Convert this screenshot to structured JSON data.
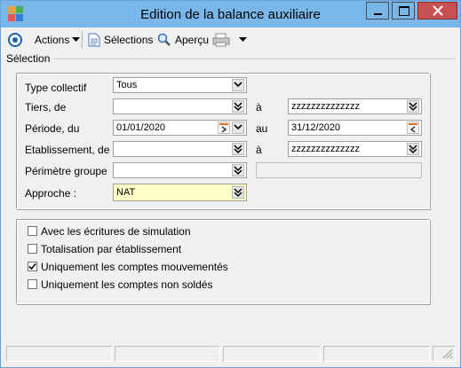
{
  "window": {
    "title": "Edition de la balance auxiliaire"
  },
  "toolbar": {
    "actions_label": "Actions",
    "selections_label": "Sélections",
    "apercu_label": "Aperçu"
  },
  "section": {
    "label": "Sélection"
  },
  "form": {
    "type_collectif": {
      "label": "Type collectif",
      "value": "Tous"
    },
    "tiers": {
      "label": "Tiers, de",
      "from": "",
      "sep": "à",
      "to": "zzzzzzzzzzzzzz"
    },
    "periode": {
      "label": "Période, du",
      "from": "01/01/2020",
      "sep": "au",
      "to": "31/12/2020"
    },
    "etablissement": {
      "label": "Etablissement, de",
      "from": "",
      "sep": "à",
      "to": "zzzzzzzzzzzzzz"
    },
    "perimetre": {
      "label": "Périmètre groupe",
      "value": "",
      "extra": ""
    },
    "approche": {
      "label": "Approche :",
      "value": "NAT"
    }
  },
  "options": [
    {
      "label": "Avec les écritures de simulation",
      "checked": false
    },
    {
      "label": "Totalisation par établissement",
      "checked": false
    },
    {
      "label": "Uniquement les comptes mouvementés",
      "checked": true
    },
    {
      "label": "Uniquement les comptes non soldés",
      "checked": false
    }
  ],
  "colors": {
    "titlebar": "#79b7ea",
    "close": "#c75050",
    "approche_bg": "#ffffc8",
    "accent": "#1a5fb4"
  }
}
